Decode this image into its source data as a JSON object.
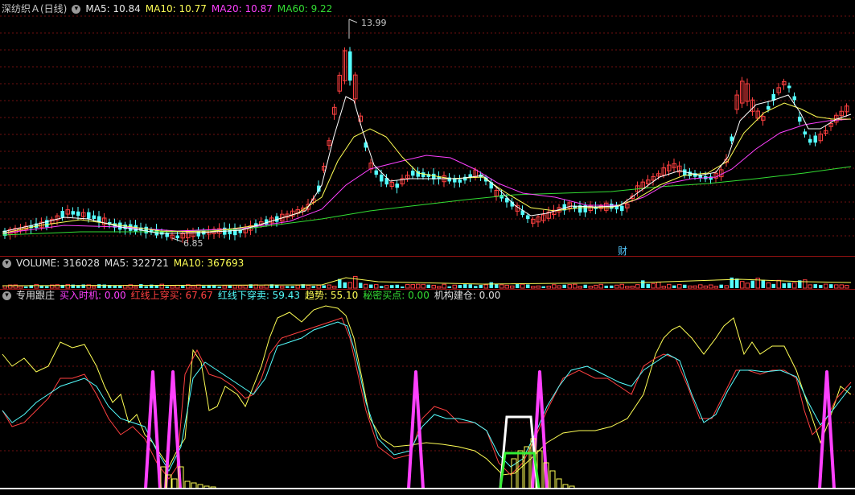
{
  "colors": {
    "up": "#ff4040",
    "down": "#54ffff",
    "ma5": "#ffffff",
    "ma10": "#ffff55",
    "ma20": "#ff40ff",
    "ma60": "#33dd33",
    "grid": "#701010",
    "sep": "#a01010"
  },
  "main": {
    "title": "深纺织Ａ(日线)",
    "ma5": "MA5: 10.84",
    "ma10": "MA10: 10.77",
    "ma20": "MA20: 10.87",
    "ma60": "MA60: 9.22",
    "high_label": "13.99",
    "low_label": "6.85",
    "fin_marker": "财"
  },
  "volume": {
    "label": "VOLUME: 316028",
    "ma5": "MA5: 322721",
    "ma10": "MA10: 367693"
  },
  "indicator": {
    "name": "专用跟庄",
    "buy_time": "买入时机: 0.00",
    "red_up": "红线上穿买: 67.67",
    "red_down": "红线下穿卖: 59.43",
    "trend": "趋势: 55.10",
    "secret": "秘密买点: 0.00",
    "inst": "机构建仓: 0.00"
  },
  "chart_data": [
    {
      "type": "candlestick",
      "title": "深纺织Ａ(日线)",
      "series": [
        {
          "name": "MA5",
          "value": 10.84
        },
        {
          "name": "MA10",
          "value": 10.77
        },
        {
          "name": "MA20",
          "value": 10.87
        },
        {
          "name": "MA60",
          "value": 9.22
        }
      ],
      "annotations": {
        "high": 13.99,
        "low": 6.85
      }
    },
    {
      "type": "bar",
      "title": "VOLUME",
      "value": 316028,
      "series": [
        {
          "name": "MA5",
          "value": 322721
        },
        {
          "name": "MA10",
          "value": 367693
        }
      ]
    },
    {
      "type": "line",
      "title": "专用跟庄",
      "series": [
        {
          "name": "买入时机",
          "value": 0.0
        },
        {
          "name": "红线上穿买",
          "value": 67.67
        },
        {
          "name": "红线下穿卖",
          "value": 59.43
        },
        {
          "name": "趋势",
          "value": 55.1
        },
        {
          "name": "秘密买点",
          "value": 0.0
        },
        {
          "name": "机构建仓",
          "value": 0.0
        }
      ]
    }
  ]
}
